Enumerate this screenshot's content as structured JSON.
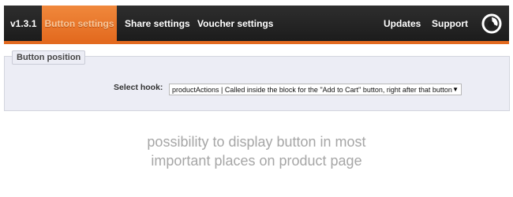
{
  "nav": {
    "version": "v1.3.1",
    "items": [
      {
        "label": "Button settings"
      },
      {
        "label": "Share settings"
      },
      {
        "label": "Voucher settings"
      },
      {
        "label": "Updates"
      },
      {
        "label": "Support"
      }
    ],
    "logo_icon": "swirl-logo-icon",
    "accent_color": "#e36a1f"
  },
  "panel": {
    "legend": "Button position",
    "hook_label": "Select hook:",
    "hook_value": "productActions | Called inside the block for the \"Add to Cart\" button, right after that button",
    "dropdown_icon": "triangle-down-icon"
  },
  "caption": {
    "line1": "possibility to display button in most",
    "line2": "important places on product page"
  }
}
